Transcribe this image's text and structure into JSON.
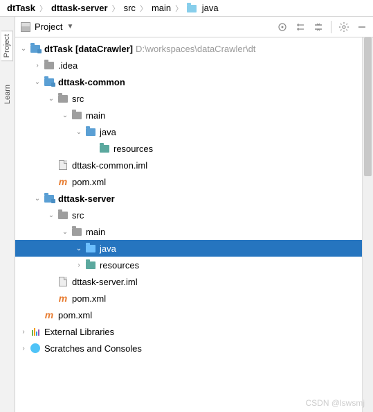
{
  "breadcrumb": [
    {
      "label": "dtTask",
      "bold": true
    },
    {
      "label": "dttask-server",
      "bold": true
    },
    {
      "label": "src",
      "bold": false
    },
    {
      "label": "main",
      "bold": false
    },
    {
      "label": "java",
      "bold": false,
      "icon": true
    }
  ],
  "panel": {
    "title": "Project",
    "actions": {
      "target": "target-icon",
      "expand": "expand-icon",
      "collapse": "collapse-icon",
      "settings": "settings-icon",
      "hide": "hide-icon"
    }
  },
  "gutter": {
    "project": "Project",
    "learn": "Learn"
  },
  "tree": {
    "root": {
      "label": "dtTask",
      "extra": "[dataCrawler]",
      "path": "D:\\workspaces\\dataCrawler\\dt"
    },
    "idea": ".idea",
    "common": {
      "label": "dttask-common",
      "src": "src",
      "main": "main",
      "java": "java",
      "resources": "resources",
      "iml": "dttask-common.iml",
      "pom": "pom.xml"
    },
    "server": {
      "label": "dttask-server",
      "src": "src",
      "main": "main",
      "java": "java",
      "resources": "resources",
      "iml": "dttask-server.iml",
      "pom": "pom.xml"
    },
    "rootPom": "pom.xml",
    "externalLibs": "External Libraries",
    "scratches": "Scratches and Consoles"
  },
  "watermark": "CSDN @lswsmj"
}
